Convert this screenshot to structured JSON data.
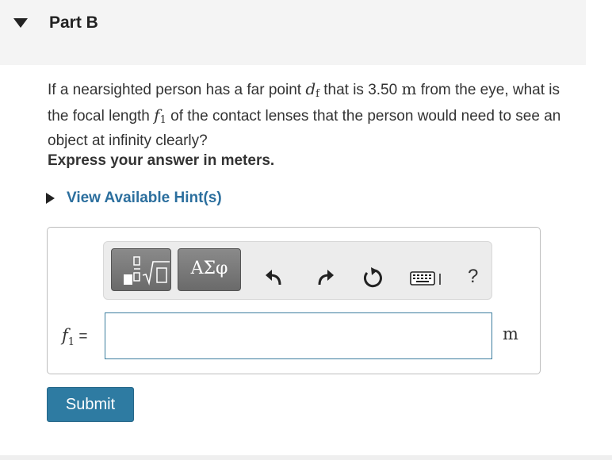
{
  "part": {
    "title": "Part B"
  },
  "question": {
    "text_1": "If a nearsighted person has a far point ",
    "far_point_symbol": "d",
    "far_point_subscript": "f",
    "text_2": " that is 3.50 ",
    "unit_inline": "m",
    "text_3": " from the eye, what is the focal length ",
    "focal_symbol": "f",
    "focal_subscript": "1",
    "text_4": " of the contact lenses that the person would need to see an object at infinity clearly?"
  },
  "instruction": "Express your answer in meters.",
  "hint": {
    "label": "View Available Hint(s)"
  },
  "toolbar": {
    "symbols_label": "ΑΣφ",
    "help_label": "?",
    "icons": [
      "templates-icon",
      "greek-symbols-icon",
      "undo-icon",
      "redo-icon",
      "reset-icon",
      "keyboard-icon",
      "help-icon"
    ]
  },
  "answer": {
    "variable_symbol": "f",
    "variable_subscript": "1",
    "equals": " =",
    "value": "",
    "unit": "m"
  },
  "submit": {
    "label": "Submit"
  },
  "colors": {
    "accent": "#2e7ba2",
    "link": "#2c6f9e",
    "input_border": "#3c7d9e"
  }
}
